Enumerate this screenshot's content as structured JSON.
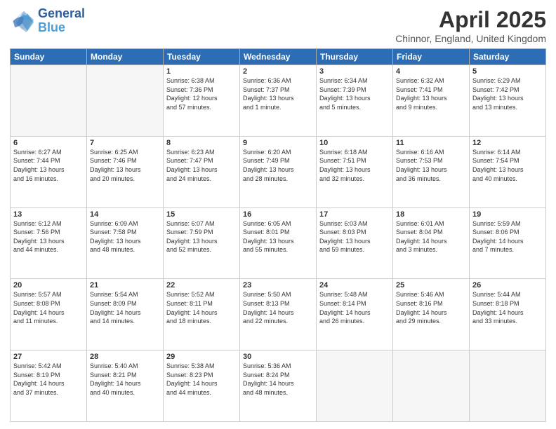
{
  "header": {
    "logo_general": "General",
    "logo_blue": "Blue",
    "month_title": "April 2025",
    "location": "Chinnor, England, United Kingdom"
  },
  "days_of_week": [
    "Sunday",
    "Monday",
    "Tuesday",
    "Wednesday",
    "Thursday",
    "Friday",
    "Saturday"
  ],
  "weeks": [
    [
      {
        "day": "",
        "empty": true
      },
      {
        "day": "",
        "empty": true
      },
      {
        "day": "1",
        "line1": "Sunrise: 6:38 AM",
        "line2": "Sunset: 7:36 PM",
        "line3": "Daylight: 12 hours",
        "line4": "and 57 minutes."
      },
      {
        "day": "2",
        "line1": "Sunrise: 6:36 AM",
        "line2": "Sunset: 7:37 PM",
        "line3": "Daylight: 13 hours",
        "line4": "and 1 minute."
      },
      {
        "day": "3",
        "line1": "Sunrise: 6:34 AM",
        "line2": "Sunset: 7:39 PM",
        "line3": "Daylight: 13 hours",
        "line4": "and 5 minutes."
      },
      {
        "day": "4",
        "line1": "Sunrise: 6:32 AM",
        "line2": "Sunset: 7:41 PM",
        "line3": "Daylight: 13 hours",
        "line4": "and 9 minutes."
      },
      {
        "day": "5",
        "line1": "Sunrise: 6:29 AM",
        "line2": "Sunset: 7:42 PM",
        "line3": "Daylight: 13 hours",
        "line4": "and 13 minutes."
      }
    ],
    [
      {
        "day": "6",
        "line1": "Sunrise: 6:27 AM",
        "line2": "Sunset: 7:44 PM",
        "line3": "Daylight: 13 hours",
        "line4": "and 16 minutes."
      },
      {
        "day": "7",
        "line1": "Sunrise: 6:25 AM",
        "line2": "Sunset: 7:46 PM",
        "line3": "Daylight: 13 hours",
        "line4": "and 20 minutes."
      },
      {
        "day": "8",
        "line1": "Sunrise: 6:23 AM",
        "line2": "Sunset: 7:47 PM",
        "line3": "Daylight: 13 hours",
        "line4": "and 24 minutes."
      },
      {
        "day": "9",
        "line1": "Sunrise: 6:20 AM",
        "line2": "Sunset: 7:49 PM",
        "line3": "Daylight: 13 hours",
        "line4": "and 28 minutes."
      },
      {
        "day": "10",
        "line1": "Sunrise: 6:18 AM",
        "line2": "Sunset: 7:51 PM",
        "line3": "Daylight: 13 hours",
        "line4": "and 32 minutes."
      },
      {
        "day": "11",
        "line1": "Sunrise: 6:16 AM",
        "line2": "Sunset: 7:53 PM",
        "line3": "Daylight: 13 hours",
        "line4": "and 36 minutes."
      },
      {
        "day": "12",
        "line1": "Sunrise: 6:14 AM",
        "line2": "Sunset: 7:54 PM",
        "line3": "Daylight: 13 hours",
        "line4": "and 40 minutes."
      }
    ],
    [
      {
        "day": "13",
        "line1": "Sunrise: 6:12 AM",
        "line2": "Sunset: 7:56 PM",
        "line3": "Daylight: 13 hours",
        "line4": "and 44 minutes."
      },
      {
        "day": "14",
        "line1": "Sunrise: 6:09 AM",
        "line2": "Sunset: 7:58 PM",
        "line3": "Daylight: 13 hours",
        "line4": "and 48 minutes."
      },
      {
        "day": "15",
        "line1": "Sunrise: 6:07 AM",
        "line2": "Sunset: 7:59 PM",
        "line3": "Daylight: 13 hours",
        "line4": "and 52 minutes."
      },
      {
        "day": "16",
        "line1": "Sunrise: 6:05 AM",
        "line2": "Sunset: 8:01 PM",
        "line3": "Daylight: 13 hours",
        "line4": "and 55 minutes."
      },
      {
        "day": "17",
        "line1": "Sunrise: 6:03 AM",
        "line2": "Sunset: 8:03 PM",
        "line3": "Daylight: 13 hours",
        "line4": "and 59 minutes."
      },
      {
        "day": "18",
        "line1": "Sunrise: 6:01 AM",
        "line2": "Sunset: 8:04 PM",
        "line3": "Daylight: 14 hours",
        "line4": "and 3 minutes."
      },
      {
        "day": "19",
        "line1": "Sunrise: 5:59 AM",
        "line2": "Sunset: 8:06 PM",
        "line3": "Daylight: 14 hours",
        "line4": "and 7 minutes."
      }
    ],
    [
      {
        "day": "20",
        "line1": "Sunrise: 5:57 AM",
        "line2": "Sunset: 8:08 PM",
        "line3": "Daylight: 14 hours",
        "line4": "and 11 minutes."
      },
      {
        "day": "21",
        "line1": "Sunrise: 5:54 AM",
        "line2": "Sunset: 8:09 PM",
        "line3": "Daylight: 14 hours",
        "line4": "and 14 minutes."
      },
      {
        "day": "22",
        "line1": "Sunrise: 5:52 AM",
        "line2": "Sunset: 8:11 PM",
        "line3": "Daylight: 14 hours",
        "line4": "and 18 minutes."
      },
      {
        "day": "23",
        "line1": "Sunrise: 5:50 AM",
        "line2": "Sunset: 8:13 PM",
        "line3": "Daylight: 14 hours",
        "line4": "and 22 minutes."
      },
      {
        "day": "24",
        "line1": "Sunrise: 5:48 AM",
        "line2": "Sunset: 8:14 PM",
        "line3": "Daylight: 14 hours",
        "line4": "and 26 minutes."
      },
      {
        "day": "25",
        "line1": "Sunrise: 5:46 AM",
        "line2": "Sunset: 8:16 PM",
        "line3": "Daylight: 14 hours",
        "line4": "and 29 minutes."
      },
      {
        "day": "26",
        "line1": "Sunrise: 5:44 AM",
        "line2": "Sunset: 8:18 PM",
        "line3": "Daylight: 14 hours",
        "line4": "and 33 minutes."
      }
    ],
    [
      {
        "day": "27",
        "line1": "Sunrise: 5:42 AM",
        "line2": "Sunset: 8:19 PM",
        "line3": "Daylight: 14 hours",
        "line4": "and 37 minutes."
      },
      {
        "day": "28",
        "line1": "Sunrise: 5:40 AM",
        "line2": "Sunset: 8:21 PM",
        "line3": "Daylight: 14 hours",
        "line4": "and 40 minutes."
      },
      {
        "day": "29",
        "line1": "Sunrise: 5:38 AM",
        "line2": "Sunset: 8:23 PM",
        "line3": "Daylight: 14 hours",
        "line4": "and 44 minutes."
      },
      {
        "day": "30",
        "line1": "Sunrise: 5:36 AM",
        "line2": "Sunset: 8:24 PM",
        "line3": "Daylight: 14 hours",
        "line4": "and 48 minutes."
      },
      {
        "day": "",
        "empty": true
      },
      {
        "day": "",
        "empty": true
      },
      {
        "day": "",
        "empty": true
      }
    ]
  ]
}
